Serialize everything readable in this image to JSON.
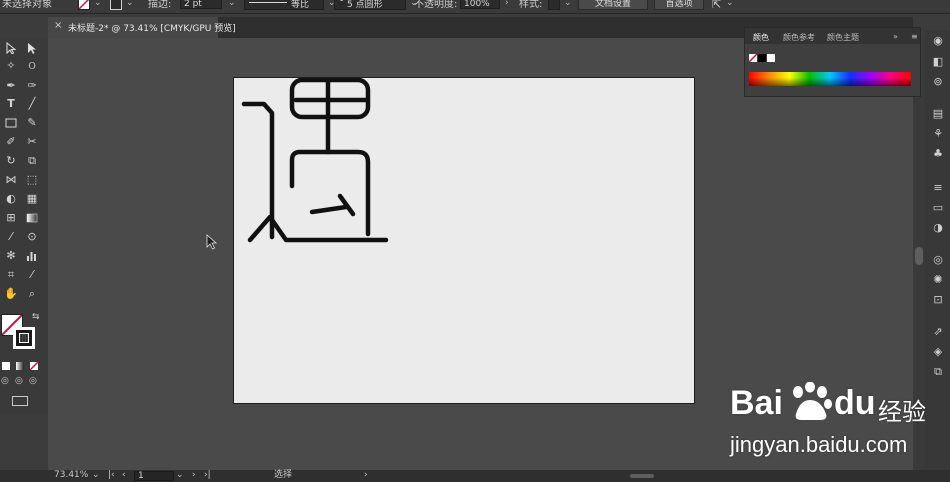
{
  "control_bar": {
    "selection_status": "未选择对象",
    "stroke_label": "描边:",
    "stroke_weight": "2 pt",
    "profile": "等比",
    "brush": "5 点圆形",
    "opacity_label": "不透明度:",
    "opacity_value": "100%",
    "style_label": "样式:",
    "doc_setup_button": "文档设置",
    "preferences_button": "首选项"
  },
  "document": {
    "tab_title": "未标题-2* @ 73.41% [CMYK/GPU 预览]",
    "close_symbol": "×"
  },
  "color_panel": {
    "tabs": [
      "颜色",
      "颜色参考",
      "颜色主题"
    ],
    "menu_symbol": "≡",
    "collapse_symbol": "»"
  },
  "status_bar": {
    "zoom": "73.41%",
    "artboard_number": "1",
    "tool_label": "选择"
  },
  "watermark": {
    "brand": "Bai",
    "brand_tail": "du",
    "product": "经验",
    "url": "jingyan.baidu.com"
  },
  "colors": {
    "artboard": "#ebebeb",
    "pasteboard": "#4a4a4a",
    "stroke": "#111111",
    "none_slash": "#d0103a"
  }
}
